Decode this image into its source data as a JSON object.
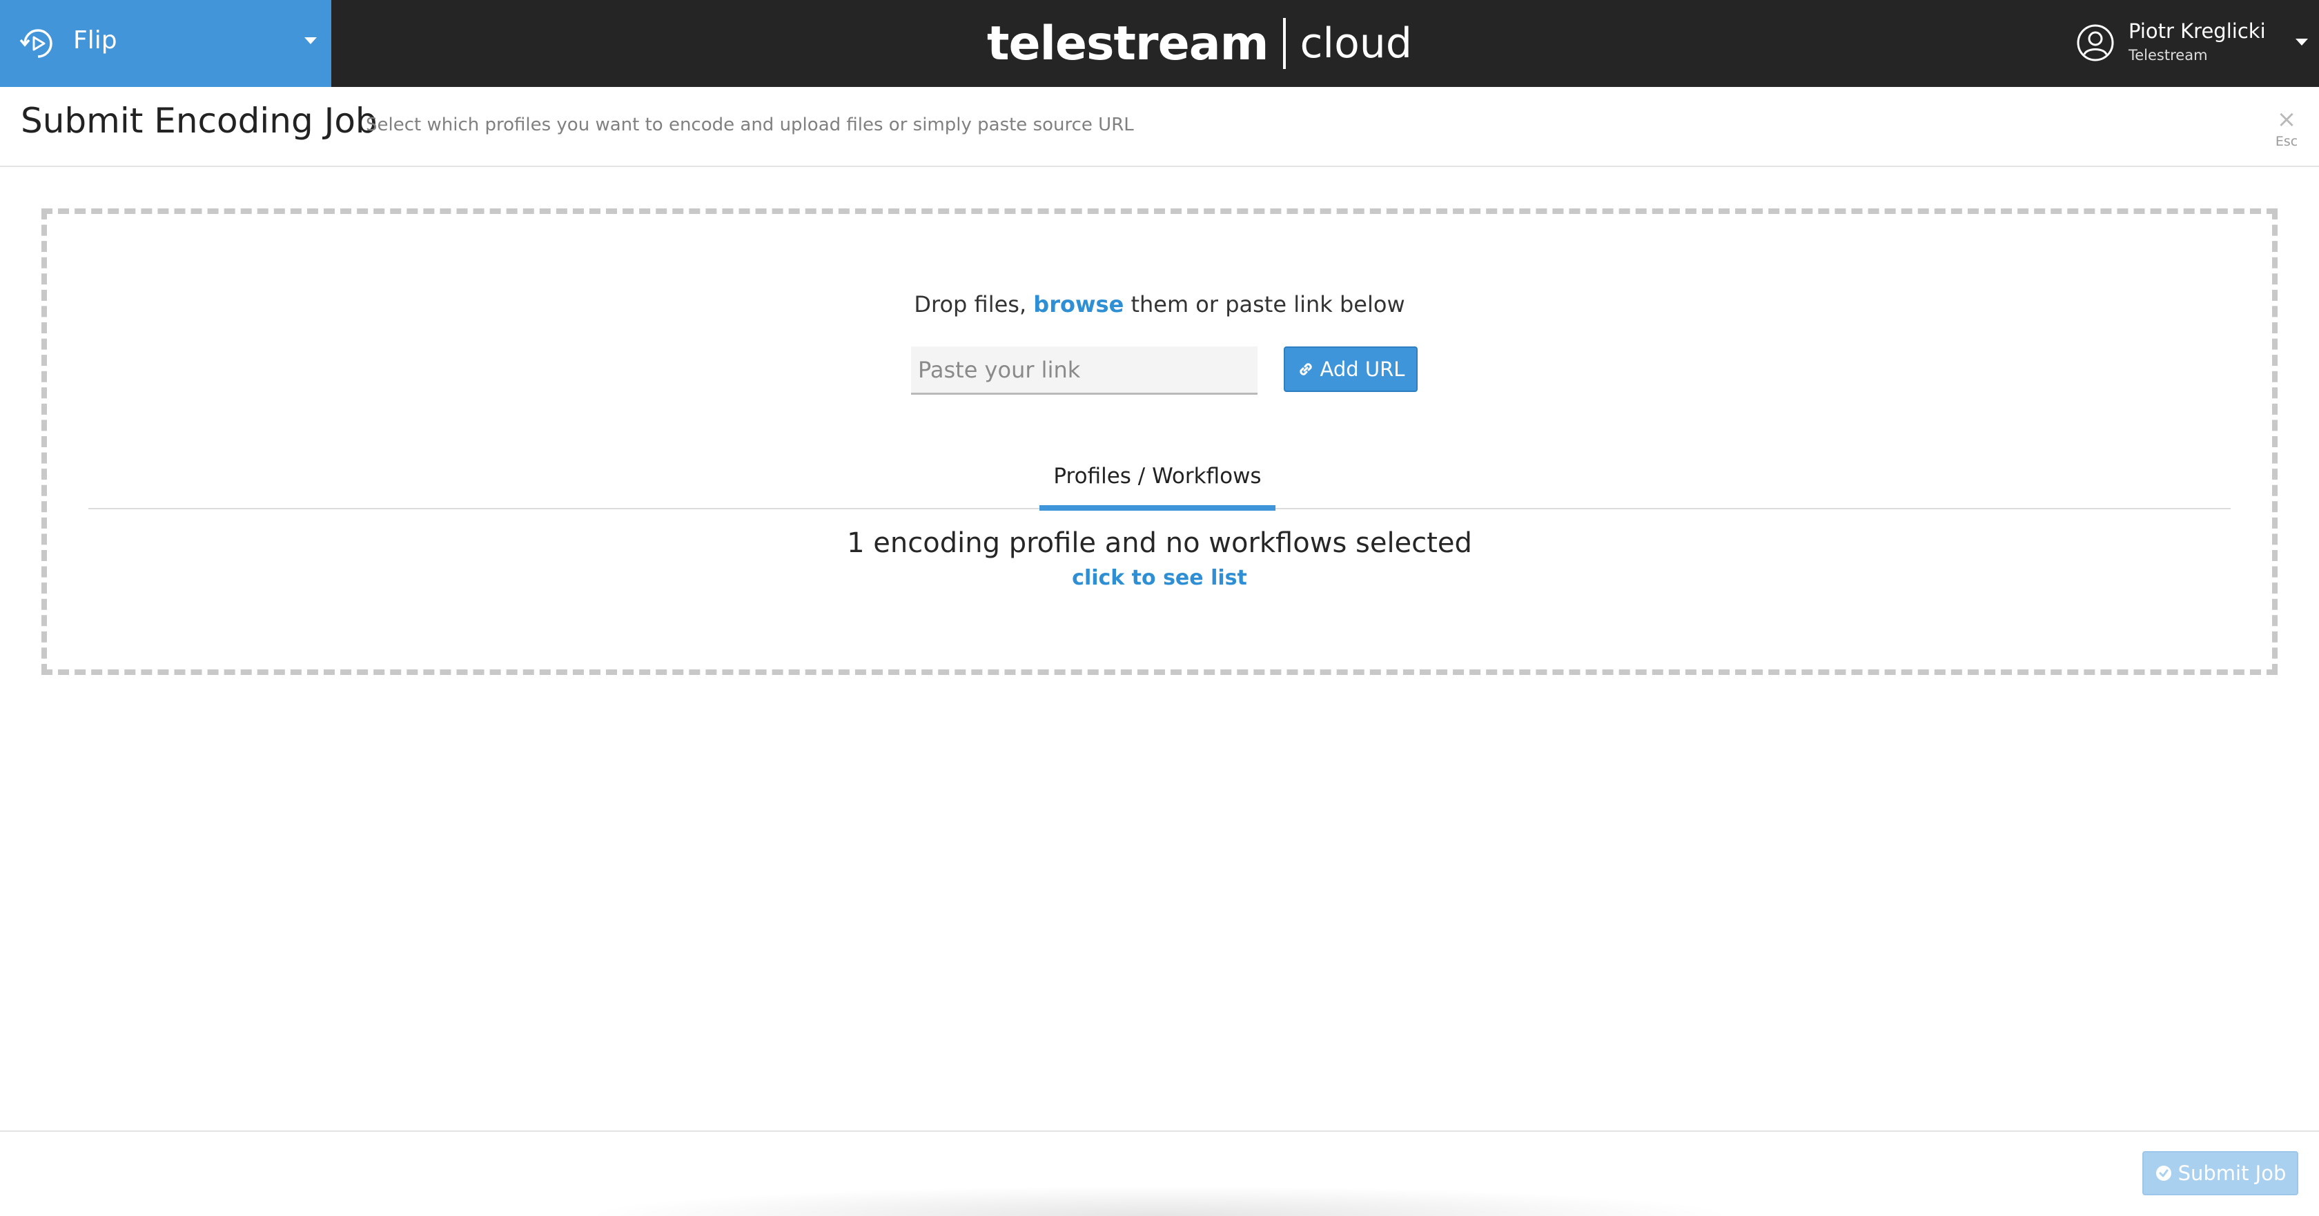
{
  "topbar": {
    "app_name": "Flip",
    "app_icon": "flip-play-icon",
    "brand_name": "telestream",
    "brand_product": "cloud",
    "user": {
      "name": "Piotr Kreglicki",
      "organization": "Telestream",
      "avatar_icon": "user-circle-icon"
    }
  },
  "header": {
    "title": "Submit Encoding Job",
    "subtitle": "Select which profiles you want to encode and upload files or simply paste source URL",
    "close_glyph": "×",
    "close_hint": "Esc"
  },
  "dropzone": {
    "text_before": "Drop files, ",
    "browse_label": "browse",
    "text_after": " them or paste link below",
    "link_input": {
      "placeholder": "Paste your link",
      "value": ""
    },
    "add_url_label": "Add URL",
    "tabs": [
      {
        "label": "Profiles / Workflows",
        "active": true
      }
    ],
    "summary": "1 encoding profile and no workflows selected",
    "see_list_label": "click to see list"
  },
  "footer": {
    "submit_label": "Submit Job",
    "submit_enabled": false
  },
  "colors": {
    "accent": "#3f95d9",
    "topbar": "#252525",
    "app_switcher": "#4295d9",
    "link": "#2f8fd4",
    "submit_disabled": "#a9d0ef"
  }
}
